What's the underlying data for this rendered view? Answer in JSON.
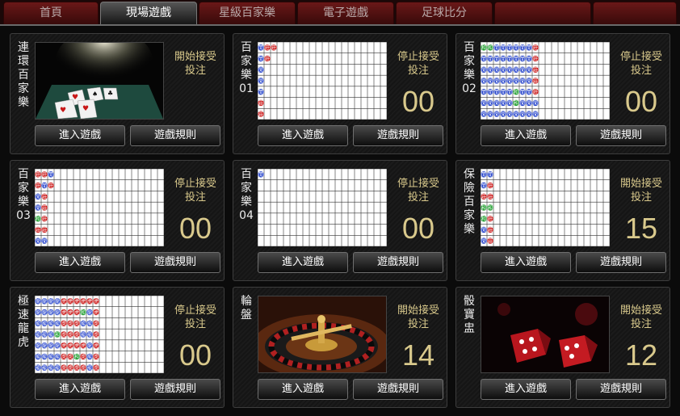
{
  "tabs": [
    {
      "label": "首頁",
      "active": false
    },
    {
      "label": "現場遊戲",
      "active": true
    },
    {
      "label": "星級百家樂",
      "active": false
    },
    {
      "label": "電子遊戲",
      "active": false
    },
    {
      "label": "足球比分",
      "active": false
    },
    {
      "label": "",
      "active": false
    }
  ],
  "colors": {
    "banker": "#cc1f1f",
    "player": "#1f3ec9",
    "tie": "#1f9d2e",
    "accent": "#d9c98c"
  },
  "games": [
    {
      "name": "連環百家樂",
      "status": "開始接受投注",
      "countdown": "",
      "display": "image",
      "image": "baccarat-table-photo",
      "enter_label": "進入遊戲",
      "rules_label": "遊戲規則"
    },
    {
      "name": "百家樂01",
      "status": "停止接受投注",
      "countdown": "00",
      "display": "road",
      "columns": [
        [
          "閒",
          "閒",
          "閒",
          "閒",
          "閒",
          "莊",
          "莊"
        ],
        [
          "莊",
          "莊"
        ],
        [
          "莊"
        ]
      ],
      "enter_label": "進入遊戲",
      "rules_label": "遊戲規則"
    },
    {
      "name": "百家樂02",
      "status": "停止接受投注",
      "countdown": "00",
      "display": "road",
      "columns": [
        [
          "和",
          "閒",
          "閒",
          "閒",
          "閒",
          "閒",
          "閒"
        ],
        [
          "和",
          "閒",
          "閒",
          "閒",
          "閒",
          "閒",
          "閒"
        ],
        [
          "閒",
          "閒",
          "閒",
          "閒",
          "閒",
          "閒",
          "閒"
        ],
        [
          "閒",
          "閒",
          "閒",
          "閒",
          "閒",
          "閒",
          "閒"
        ],
        [
          "閒",
          "閒",
          "閒",
          "閒",
          "閒",
          "閒",
          "閒"
        ],
        [
          "閒",
          "閒",
          "閒",
          "閒",
          "和",
          "和",
          "閒"
        ],
        [
          "閒",
          "閒",
          "閒",
          "閒",
          "閒",
          "閒",
          "閒"
        ],
        [
          "閒",
          "閒",
          "閒",
          "閒",
          "閒",
          "閒",
          "閒"
        ],
        [
          "莊",
          "莊",
          "莊",
          "莊",
          "莊",
          "閒",
          "閒"
        ]
      ],
      "enter_label": "進入遊戲",
      "rules_label": "遊戲規則"
    },
    {
      "name": "百家樂03",
      "status": "停止接受投注",
      "countdown": "00",
      "display": "road",
      "columns": [
        [
          "莊",
          "莊",
          "閒",
          "閒",
          "和",
          "莊",
          "閒"
        ],
        [
          "莊",
          "閒",
          "莊",
          "莊",
          "莊",
          "莊",
          "閒"
        ],
        [
          "閒",
          "莊"
        ]
      ],
      "enter_label": "進入遊戲",
      "rules_label": "遊戲規則"
    },
    {
      "name": "百家樂04",
      "status": "停止接受投注",
      "countdown": "00",
      "display": "road",
      "columns": [
        [
          "閒"
        ]
      ],
      "enter_label": "進入遊戲",
      "rules_label": "遊戲規則"
    },
    {
      "name": "保險百家樂",
      "status": "開始接受投注",
      "countdown": "15",
      "display": "road",
      "columns": [
        [
          "閒",
          "閒",
          "莊",
          "和",
          "和",
          "閒",
          "閒"
        ],
        [
          "閒",
          "莊",
          "莊",
          "和",
          "莊",
          "莊",
          "莊"
        ]
      ],
      "enter_label": "進入遊戲",
      "rules_label": "遊戲規則"
    },
    {
      "name": "極速龍虎",
      "status": "停止接受投注",
      "countdown": "00",
      "display": "road",
      "columns": [
        [
          "龍",
          "龍",
          "龍",
          "龍",
          "龍",
          "龍",
          "龍"
        ],
        [
          "龍",
          "龍",
          "龍",
          "龍",
          "龍",
          "龍",
          "龍"
        ],
        [
          "龍",
          "龍",
          "龍",
          "龍",
          "龍",
          "龍",
          "龍"
        ],
        [
          "龍",
          "龍",
          "龍",
          "和",
          "龍",
          "龍",
          "龍"
        ],
        [
          "虎",
          "虎",
          "虎",
          "虎",
          "虎",
          "虎",
          "虎"
        ],
        [
          "虎",
          "虎",
          "虎",
          "虎",
          "虎",
          "虎",
          "虎"
        ],
        [
          "虎",
          "虎",
          "虎",
          "虎",
          "虎",
          "和",
          "虎"
        ],
        [
          "虎",
          "和",
          "龍",
          "龍",
          "虎",
          "虎",
          "虎"
        ],
        [
          "虎",
          "龍",
          "龍",
          "龍",
          "龍",
          "龍",
          "龍"
        ],
        [
          "虎",
          "虎",
          "虎",
          "虎",
          "虎",
          "虎",
          "虎"
        ]
      ],
      "enter_label": "進入遊戲",
      "rules_label": "遊戲規則"
    },
    {
      "name": "輪盤",
      "status": "開始接受投注",
      "countdown": "14",
      "display": "image",
      "image": "roulette-wheel-photo",
      "enter_label": "進入遊戲",
      "rules_label": "遊戲規則"
    },
    {
      "name": "骰寶盅",
      "status": "開始接受投注",
      "countdown": "12",
      "display": "image",
      "image": "red-dice-photo",
      "enter_label": "進入遊戲",
      "rules_label": "遊戲規則"
    }
  ]
}
